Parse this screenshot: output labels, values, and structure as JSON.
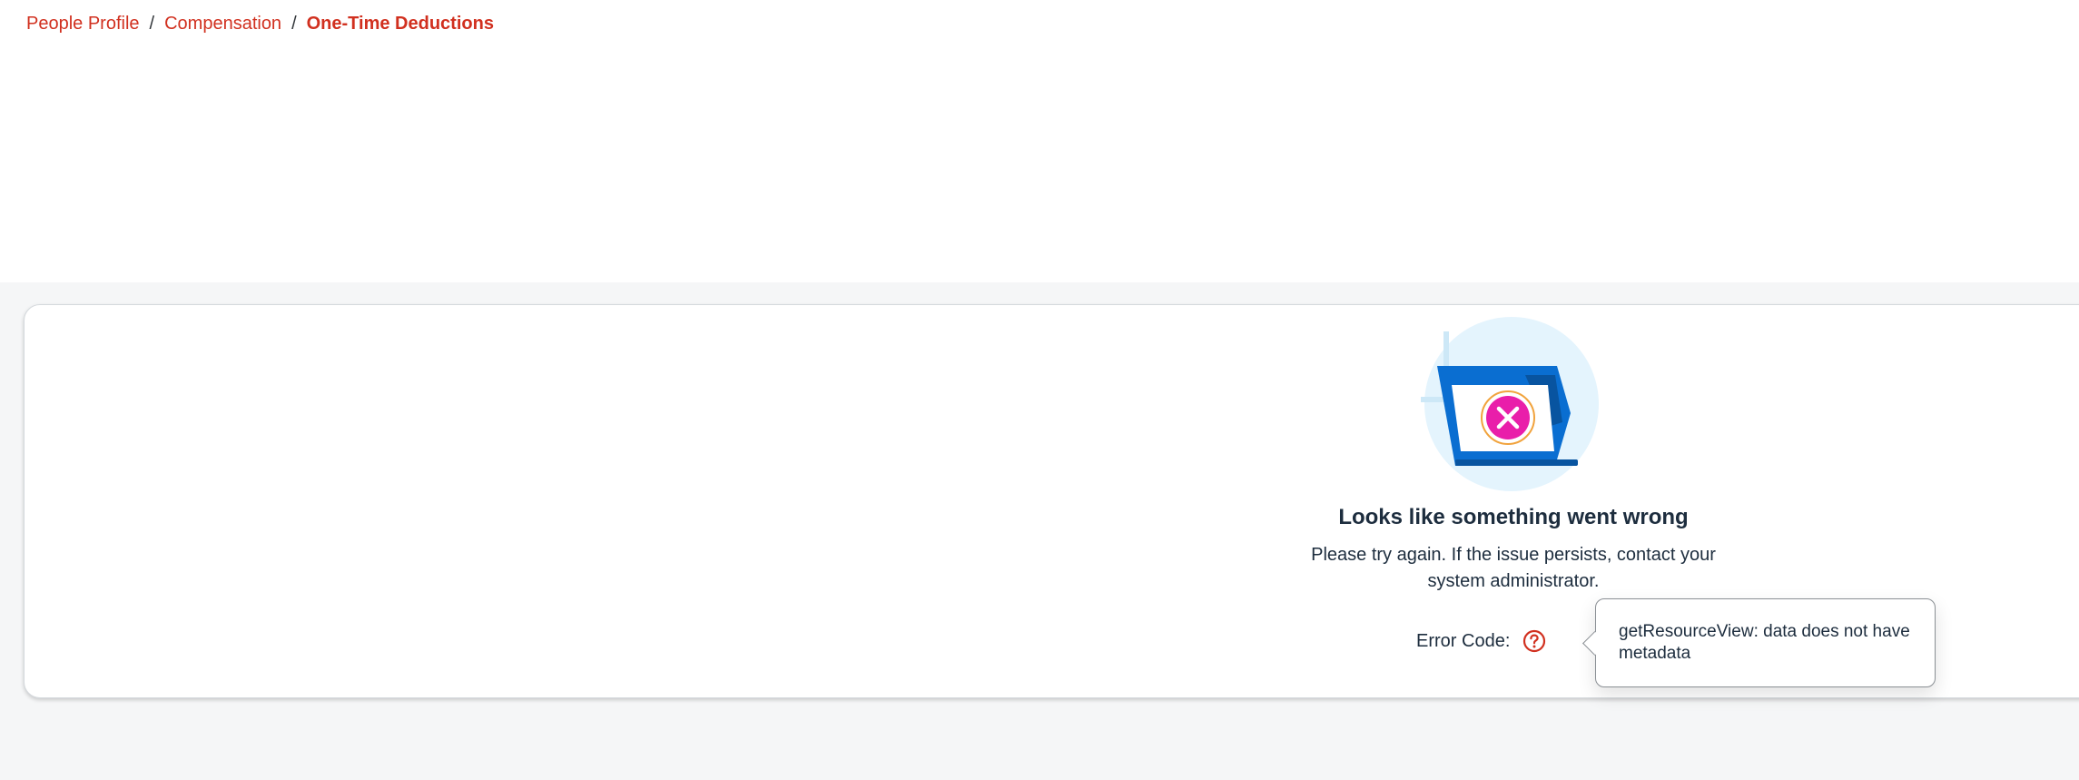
{
  "breadcrumb": {
    "items": [
      {
        "label": "People Profile"
      },
      {
        "label": "Compensation"
      }
    ],
    "separator": "/",
    "current": "One-Time Deductions"
  },
  "error": {
    "illustration": "broken-folder-error-icon",
    "title": "Looks like something went wrong",
    "description": "Please try again. If the issue persists, contact your system administrator.",
    "code_label": "Error Code:",
    "help_icon": "question-circle-icon",
    "popover_text": "getResourceView: data does not have metadata"
  },
  "colors": {
    "link": "#d1301f",
    "text": "#1d2d3e",
    "page_background": "#f5f6f7",
    "illustration_blue": "#0a6ed1",
    "error_badge": "#e91eaa"
  }
}
